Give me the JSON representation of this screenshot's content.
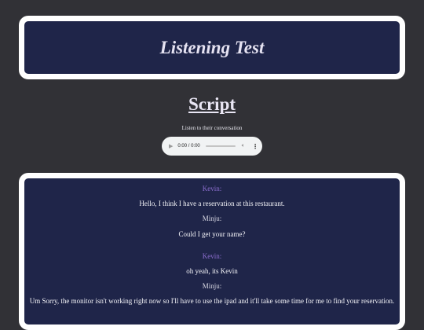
{
  "header": {
    "title": "Listening Test"
  },
  "script_section": {
    "title": "Script",
    "subtitle": "Listen to their conversation"
  },
  "audio_player": {
    "time": "0:00 / 0:00",
    "play_icon": "play-icon",
    "volume_icon": "volume-icon",
    "menu_icon": "more-vert-icon"
  },
  "dialogue": [
    {
      "speaker": "Kevin:",
      "text": "Hello, I think I have a reservation at this restaurant."
    },
    {
      "speaker": "Minju:",
      "text": "Could I get your name?"
    },
    {
      "speaker": "Kevin:",
      "text": "oh yeah, its Kevin"
    },
    {
      "speaker": "Minju:",
      "text": "Um Sorry, the monitor isn't working right now so I'll have to use the ipad and it'll take some time for me to find your reservation."
    }
  ],
  "colors": {
    "background": "#313136",
    "card": "#1f2549",
    "card_border": "#ffffff",
    "kevin": "#8d6fd0",
    "minju": "#d7d7e2"
  }
}
